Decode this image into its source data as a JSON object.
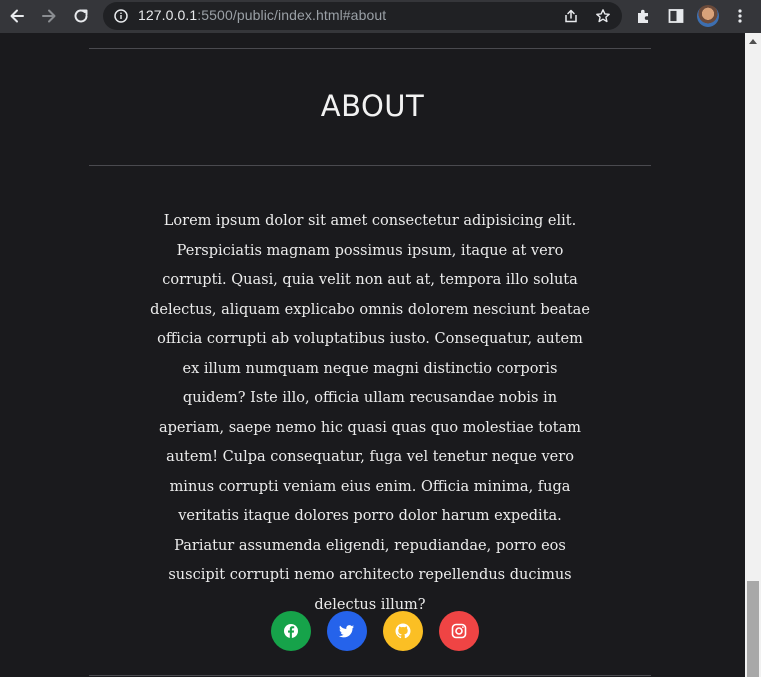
{
  "browser": {
    "url_host": "127.0.0.1",
    "url_rest": ":5500/public/index.html#about"
  },
  "about": {
    "title": "ABOUT",
    "paragraph": "Lorem ipsum dolor sit amet consectetur adipisicing elit. Perspiciatis magnam possimus ipsum, itaque at vero corrupti. Quasi, quia velit non aut at, tempora illo soluta delectus, aliquam explicabo omnis dolorem nesciunt beatae officia corrupti ab voluptatibus iusto. Consequatur, autem ex illum numquam neque magni distinctio corporis quidem? Iste illo, officia ullam recusandae nobis in aperiam, saepe nemo hic quasi quas quo molestiae totam autem! Culpa consequatur, fuga vel tenetur neque vero minus corrupti veniam eius enim. Officia minima, fuga veritatis itaque dolores porro dolor harum expedita. Pariatur assumenda eligendi, repudiandae, porro eos suscipit corrupti nemo architecto repellendus ducimus delectus illum?"
  },
  "socials": [
    {
      "icon": "facebook-icon",
      "color": "#16a34a"
    },
    {
      "icon": "twitter-icon",
      "color": "#2563eb"
    },
    {
      "icon": "github-icon",
      "color": "#fbbf24"
    },
    {
      "icon": "instagram-icon",
      "color": "#ef4444"
    }
  ],
  "colors": {
    "page_bg": "#1a1a1d",
    "rule": "#4a4a4f",
    "text": "#ececec"
  }
}
